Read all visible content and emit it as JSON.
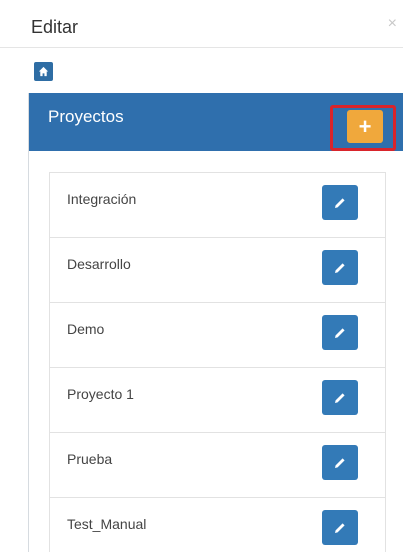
{
  "dialog": {
    "title": "Editar",
    "close_symbol": "×"
  },
  "home": {
    "icon": "home-icon"
  },
  "panel": {
    "title": "Proyectos",
    "add_symbol": "+",
    "add_color": "#f0a83c",
    "highlight_color": "#d9242b",
    "heading_color": "#2f6fad"
  },
  "projects": [
    {
      "name": "Integración",
      "edit_icon": "pencil-icon"
    },
    {
      "name": "Desarrollo",
      "edit_icon": "pencil-icon"
    },
    {
      "name": "Demo",
      "edit_icon": "pencil-icon"
    },
    {
      "name": "Proyecto 1",
      "edit_icon": "pencil-icon"
    },
    {
      "name": "Prueba",
      "edit_icon": "pencil-icon"
    },
    {
      "name": "Test_Manual",
      "edit_icon": "pencil-icon"
    }
  ]
}
